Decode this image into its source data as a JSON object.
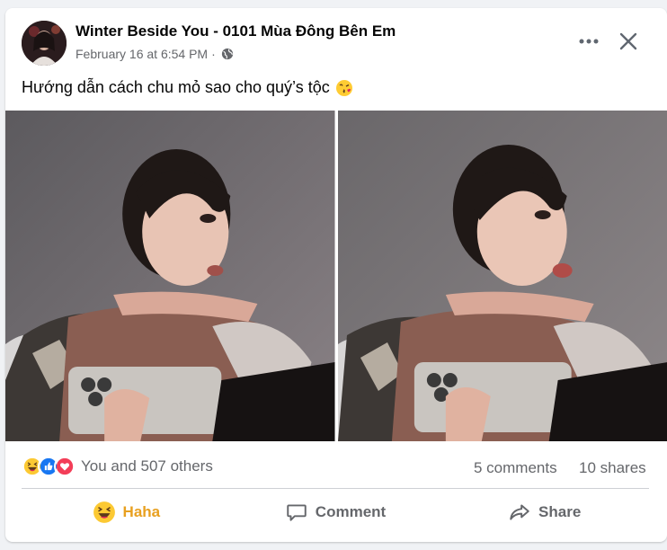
{
  "post": {
    "page_name": "Winter Beside You - 0101 Mùa Đông Bên Em",
    "date": "February 16 at 6:54 PM",
    "separator": "·",
    "caption": "Hướng dẫn cách chu mỏ sao cho quý’s tộc",
    "caption_emoji": "kissing-face-emoji"
  },
  "stats": {
    "reactions_label": "You and 507 others",
    "reaction_icons": [
      "haha-icon",
      "like-icon",
      "love-icon"
    ],
    "comments_label": "5 comments",
    "shares_label": "10 shares"
  },
  "actions": {
    "haha_label": "Haha",
    "comment_label": "Comment",
    "share_label": "Share"
  },
  "colors": {
    "haha_active": "#e8a020",
    "secondary_text": "#65676b",
    "like_blue": "#1877f2",
    "love_red": "#f33e58"
  }
}
